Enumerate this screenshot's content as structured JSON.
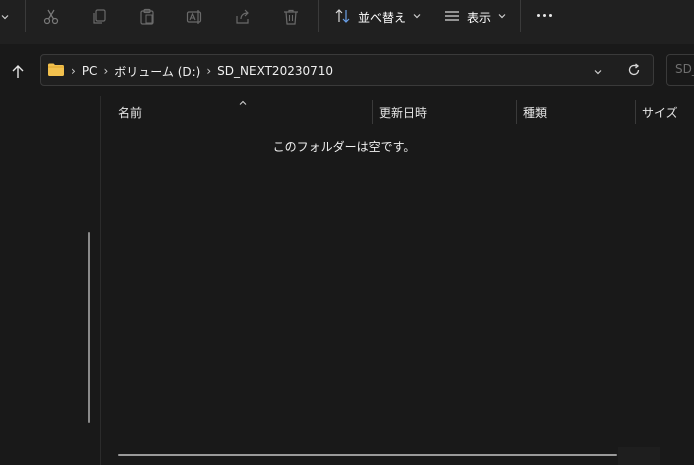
{
  "toolbar": {
    "sort_label": "並べ替え",
    "view_label": "表示",
    "icons": [
      "chevron-down-icon",
      "cut-icon",
      "copy-icon",
      "paste-icon",
      "rename-icon",
      "share-icon",
      "delete-icon",
      "sort-icon",
      "view-icon",
      "more-icon"
    ]
  },
  "address": {
    "crumbs": [
      "PC",
      "ボリューム (D:)",
      "SD_NEXT20230710"
    ],
    "search_placeholder": "SD_"
  },
  "columns": {
    "name": "名前",
    "modified": "更新日時",
    "type": "種類",
    "size": "サイズ"
  },
  "content": {
    "empty_message": "このフォルダーは空です。"
  },
  "colors": {
    "background": "#191919",
    "toolbar_bg": "#202020",
    "text": "#e6e6e6",
    "icon_disabled": "#8e8e8e",
    "folder_yellow": "#f2c14e",
    "sort_accent": "#6aa0e8"
  }
}
